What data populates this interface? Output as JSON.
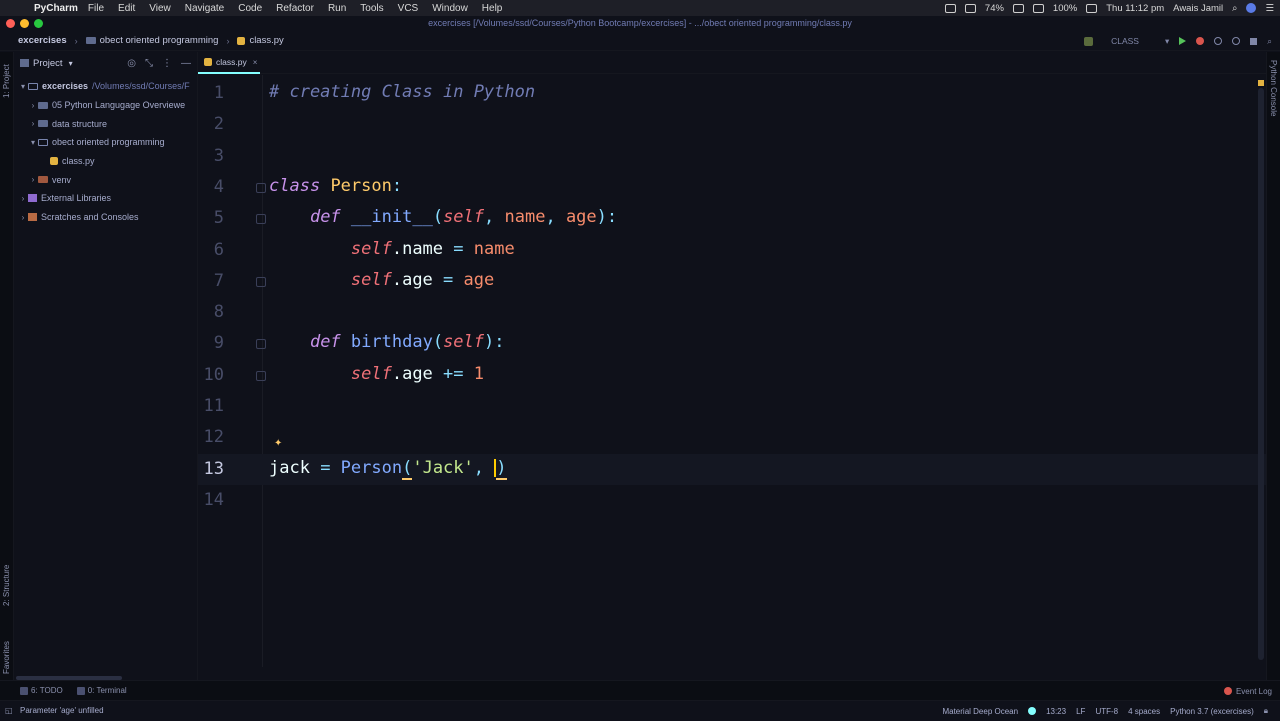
{
  "menubar": {
    "app_name": "PyCharm",
    "items": [
      "File",
      "Edit",
      "View",
      "Navigate",
      "Code",
      "Refactor",
      "Run",
      "Tools",
      "VCS",
      "Window",
      "Help"
    ],
    "battery_small": "74%",
    "battery": "100%",
    "clock": "Thu 11:12 pm",
    "user": "Awais Jamil"
  },
  "window": {
    "title": "excercises [/Volumes/ssd/Courses/Python Bootcamp/excercises] - .../obect oriented programming/class.py"
  },
  "navbar": {
    "crumbs": [
      "excercises",
      "obect oriented programming",
      "class.py"
    ],
    "run_config": "CLASS"
  },
  "left_strip": {
    "project_label": "1: Project",
    "structure_label": "2: Structure",
    "favorites_label": "Favorites"
  },
  "project_panel": {
    "title": "Project",
    "root": {
      "name": "excercises",
      "path": "/Volumes/ssd/Courses/F"
    },
    "items": [
      "05 Python Langugage Overviewe",
      "data structure",
      "obect oriented programming",
      "class.py",
      "venv",
      "External Libraries",
      "Scratches and Consoles"
    ]
  },
  "tabs": [
    {
      "label": "class.py"
    }
  ],
  "editor": {
    "line_numbers": [
      "1",
      "2",
      "3",
      "4",
      "5",
      "6",
      "7",
      "8",
      "9",
      "10",
      "11",
      "12",
      "13",
      "14"
    ],
    "tokens": {
      "comment": "# creating Class in Python",
      "class_kw": "class",
      "class_name": "Person",
      "colon": ":",
      "def_kw": "def",
      "init_name": "__init__",
      "self": "self",
      "param_name": "name",
      "param_age": "age",
      "dot_name": ".name",
      "dot_age": ".age",
      "assign": " = ",
      "birthday_name": "birthday",
      "plus_assign": " += ",
      "one": "1",
      "jack": "jack",
      "person_call": "Person",
      "jack_str": "'Jack'",
      "open_paren": "(",
      "close_paren": ")",
      "comma_space": ", ",
      "close_colon": "):"
    }
  },
  "right_strip": {
    "console_label": "Python Console"
  },
  "bottombar": {
    "todo": "6: TODO",
    "terminal": "0: Terminal",
    "event_log": "Event Log"
  },
  "statusbar": {
    "message": "Parameter 'age' unfilled",
    "theme": "Material Deep Ocean",
    "position": "13:23",
    "line_sep": "LF",
    "encoding": "UTF-8",
    "indent": "4 spaces",
    "interpreter": "Python 3.7 (excercises)"
  }
}
